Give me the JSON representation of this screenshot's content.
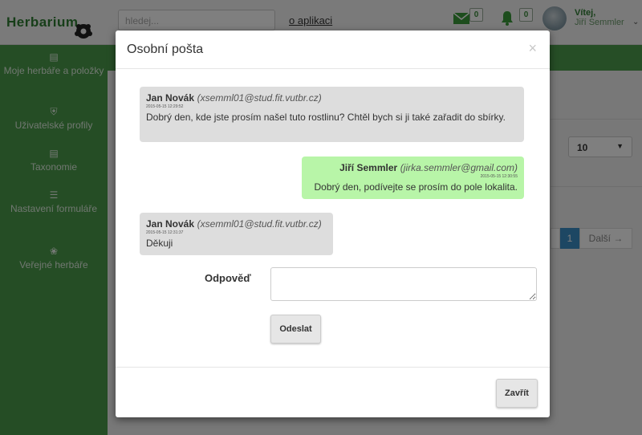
{
  "app": {
    "logo": "Herbarium",
    "search_placeholder": "hledej...",
    "about_link": "o aplikaci",
    "messages_count": "0",
    "notifications_count": "0",
    "user_greeting": "Vítej,",
    "user_name": "Jiří Semmler"
  },
  "sidebar": {
    "items": [
      {
        "label": "Moje herbáře a položky",
        "icon": "list-icon"
      },
      {
        "label": "Uživatelské profily",
        "icon": "shield-icon"
      },
      {
        "label": "Taxonomie",
        "icon": "list-icon"
      },
      {
        "label": "Nastavení formuláře",
        "icon": "list-lines-icon"
      },
      {
        "label": "Veřejné herbáře",
        "icon": "plant-icon"
      }
    ]
  },
  "background": {
    "page_size_value": "10",
    "pagination": {
      "current": "1",
      "next": "Další →"
    }
  },
  "modal": {
    "title": "Osobní pošta",
    "close_symbol": "×",
    "messages": [
      {
        "sender": "Jan Novák",
        "email": "(xsemml01@stud.fit.vutbr.cz)",
        "timestamp": "2015-05-15 12:29:52",
        "text": "Dobrý den, kde jste prosím našel tuto rostlinu? Chtěl bych si ji také zařadit do sbírky.",
        "own": false
      },
      {
        "sender": "Jiří Semmler",
        "email": "(jirka.semmler@gmail.com)",
        "timestamp": "2015-05-15 12:30:55",
        "text": "Dobrý den, podívejte se prosím do pole lokalita.",
        "own": true
      },
      {
        "sender": "Jan Novák",
        "email": "(xsemml01@stud.fit.vutbr.cz)",
        "timestamp": "2015-05-15 12:31:37",
        "text": "Děkuji",
        "own": false
      }
    ],
    "reply_label": "Odpověď",
    "reply_value": "",
    "send_label": "Odeslat",
    "close_label": "Zavřít"
  },
  "colors": {
    "brand_green": "#4a9a4a",
    "own_message_bg": "#b8f5a8",
    "other_message_bg": "#dddddd",
    "pagination_active": "#3b8fc7"
  }
}
